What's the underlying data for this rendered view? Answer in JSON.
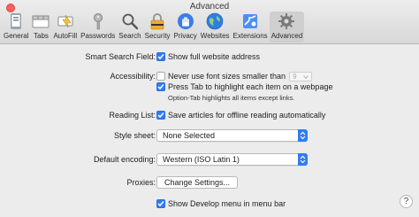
{
  "window": {
    "title": "Advanced"
  },
  "toolbar": {
    "items": [
      {
        "label": "General",
        "icon": "general-icon"
      },
      {
        "label": "Tabs",
        "icon": "tabs-icon"
      },
      {
        "label": "AutoFill",
        "icon": "autofill-icon"
      },
      {
        "label": "Passwords",
        "icon": "key-icon"
      },
      {
        "label": "Search",
        "icon": "search-icon"
      },
      {
        "label": "Security",
        "icon": "lock-icon"
      },
      {
        "label": "Privacy",
        "icon": "hand-icon"
      },
      {
        "label": "Websites",
        "icon": "globe-icon"
      },
      {
        "label": "Extensions",
        "icon": "puzzle-icon"
      },
      {
        "label": "Advanced",
        "icon": "gear-icon",
        "selected": true
      }
    ]
  },
  "settings": {
    "smart_search": {
      "label": "Smart Search Field:",
      "option": "Show full website address",
      "checked": true
    },
    "accessibility": {
      "label": "Accessibility:",
      "font_option": "Never use font sizes smaller than",
      "font_checked": false,
      "font_size_value": "9",
      "tab_option": "Press Tab to highlight each item on a webpage",
      "tab_checked": true,
      "tab_hint": "Option-Tab highlights all items except links."
    },
    "reading_list": {
      "label": "Reading List:",
      "option": "Save articles for offline reading automatically",
      "checked": true
    },
    "style_sheet": {
      "label": "Style sheet:",
      "value": "None Selected"
    },
    "encoding": {
      "label": "Default encoding:",
      "value": "Western (ISO Latin 1)"
    },
    "proxies": {
      "label": "Proxies:",
      "button": "Change Settings..."
    },
    "develop": {
      "option": "Show Develop menu in menu bar",
      "checked": true
    }
  },
  "help": {
    "label": "?"
  },
  "colors": {
    "accent": "#2f7cf6",
    "close": "#fc5f57",
    "window_bg": "#ececec"
  }
}
